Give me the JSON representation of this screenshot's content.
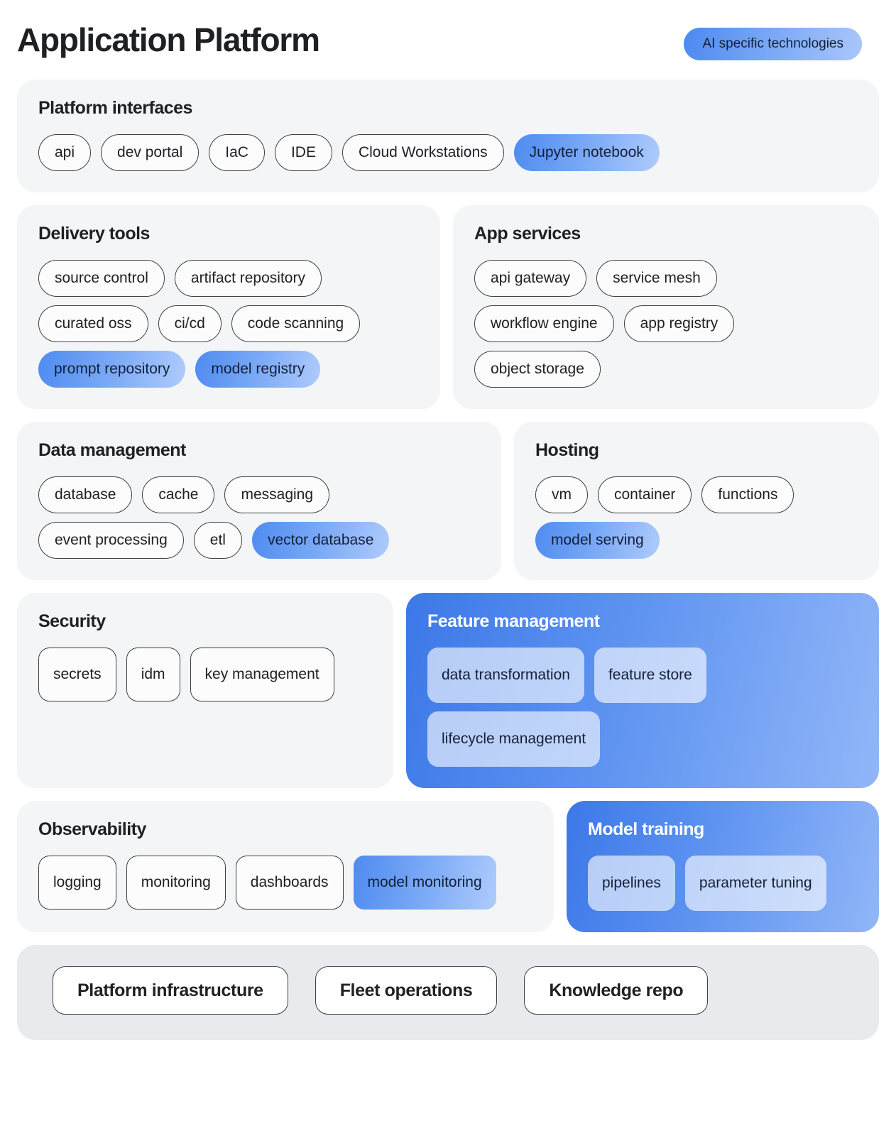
{
  "header": {
    "title": "Application Platform",
    "legend_label": "AI specific technologies",
    "legend_color": "#5b90f0"
  },
  "sections": {
    "platform_interfaces": {
      "title": "Platform interfaces",
      "items": [
        {
          "label": "api",
          "ai": false
        },
        {
          "label": "dev portal",
          "ai": false
        },
        {
          "label": "IaC",
          "ai": false
        },
        {
          "label": "IDE",
          "ai": false
        },
        {
          "label": "Cloud Workstations",
          "ai": false
        },
        {
          "label": "Jupyter notebook",
          "ai": true
        }
      ]
    },
    "delivery_tools": {
      "title": "Delivery tools",
      "items": [
        {
          "label": "source control",
          "ai": false
        },
        {
          "label": "artifact repository",
          "ai": false
        },
        {
          "label": "curated oss",
          "ai": false
        },
        {
          "label": "ci/cd",
          "ai": false
        },
        {
          "label": "code scanning",
          "ai": false
        },
        {
          "label": "prompt repository",
          "ai": true
        },
        {
          "label": "model registry",
          "ai": true
        }
      ]
    },
    "app_services": {
      "title": "App services",
      "items": [
        {
          "label": "api gateway",
          "ai": false
        },
        {
          "label": "service mesh",
          "ai": false
        },
        {
          "label": "workflow engine",
          "ai": false
        },
        {
          "label": "app registry",
          "ai": false
        },
        {
          "label": "object storage",
          "ai": false
        }
      ]
    },
    "data_management": {
      "title": "Data management",
      "items": [
        {
          "label": "database",
          "ai": false
        },
        {
          "label": "cache",
          "ai": false
        },
        {
          "label": "messaging",
          "ai": false
        },
        {
          "label": "event processing",
          "ai": false
        },
        {
          "label": "etl",
          "ai": false
        },
        {
          "label": "vector database",
          "ai": true
        }
      ]
    },
    "hosting": {
      "title": "Hosting",
      "items": [
        {
          "label": "vm",
          "ai": false
        },
        {
          "label": "container",
          "ai": false
        },
        {
          "label": "functions",
          "ai": false
        },
        {
          "label": "model serving",
          "ai": true
        }
      ]
    },
    "security": {
      "title": "Security",
      "items": [
        {
          "label": "secrets",
          "ai": false,
          "two_line": false
        },
        {
          "label": "idm",
          "ai": false,
          "two_line": false
        },
        {
          "label": "key management",
          "ai": false,
          "two_line": true
        }
      ]
    },
    "feature_management": {
      "title": "Feature management",
      "ai_section": true,
      "items": [
        {
          "label": "data transformation"
        },
        {
          "label": "feature store"
        },
        {
          "label": "lifecycle management"
        }
      ]
    },
    "observability": {
      "title": "Observability",
      "items": [
        {
          "label": "logging",
          "ai": false,
          "two_line": false
        },
        {
          "label": "monitoring",
          "ai": false,
          "two_line": false
        },
        {
          "label": "dashboards",
          "ai": false,
          "two_line": false
        },
        {
          "label": "model monitoring",
          "ai": true,
          "two_line": true
        }
      ]
    },
    "model_training": {
      "title": "Model training",
      "ai_section": true,
      "items": [
        {
          "label": "pipelines"
        },
        {
          "label": "parameter tuning"
        }
      ]
    },
    "foundation": {
      "items": [
        {
          "label": "Platform infrastructure"
        },
        {
          "label": "Fleet operations"
        },
        {
          "label": "Knowledge repo"
        }
      ]
    }
  }
}
